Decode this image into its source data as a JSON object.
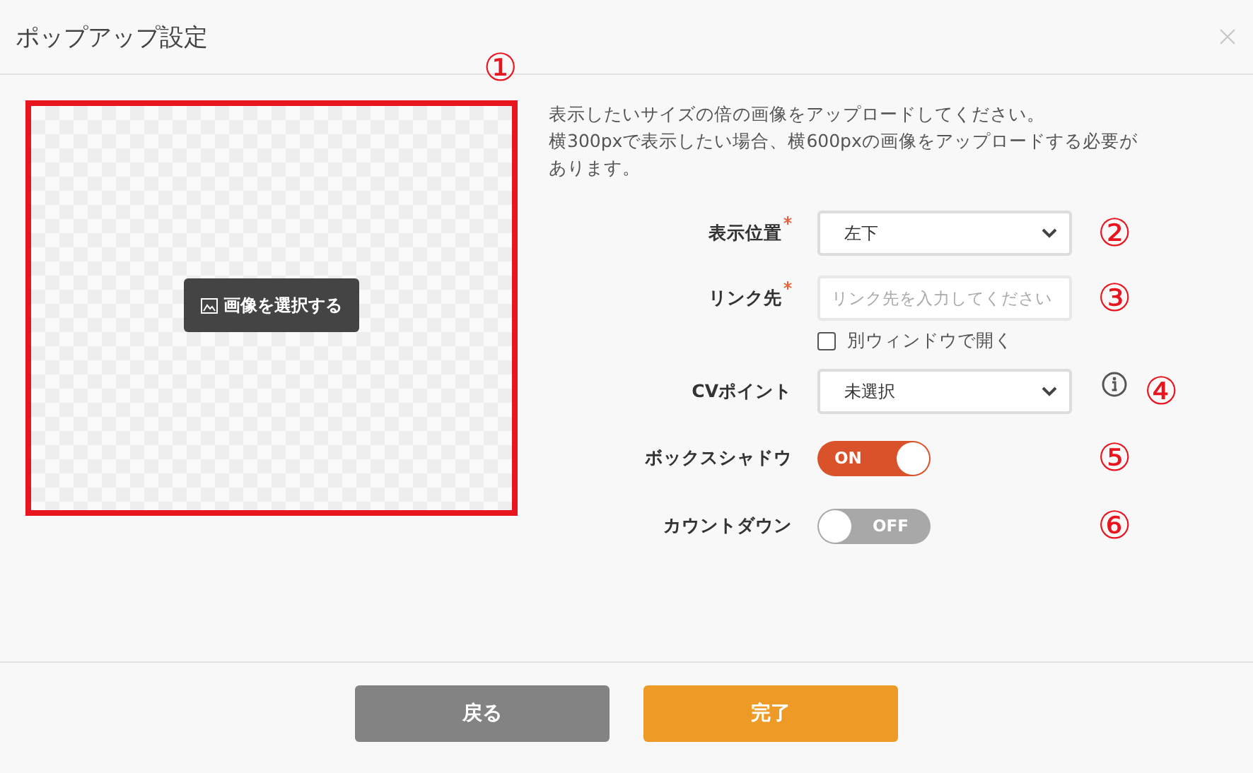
{
  "dialog": {
    "title": "ポップアップ設定"
  },
  "image_panel": {
    "button": "画像を選択する",
    "marker": "①"
  },
  "instructions": [
    "表示したいサイズの倍の画像をアップロードしてください。",
    "横300pxで表示したい場合、横600pxの画像をアップロードする必要があります。"
  ],
  "fields": [
    {
      "kind": "select",
      "label": "表示位置",
      "required": true,
      "value": "左下",
      "marker": "②"
    },
    {
      "kind": "text",
      "label": "リンク先",
      "required": true,
      "placeholder": "リンク先を入力してください",
      "marker": "③"
    },
    {
      "kind": "checkbox",
      "label": "別ウィンドウで開く",
      "checked": false
    },
    {
      "kind": "select",
      "label": "CVポイント",
      "required": false,
      "value": "未選択",
      "info": true,
      "marker": "④"
    },
    {
      "kind": "toggle",
      "label": "ボックスシャドウ",
      "on": true,
      "state_text": "ON",
      "marker": "⑤"
    },
    {
      "kind": "toggle",
      "label": "カウントダウン",
      "on": false,
      "state_text": "OFF",
      "marker": "⑥"
    }
  ],
  "buttons": [
    {
      "label": "戻る",
      "kind": "secondary"
    },
    {
      "label": "完了",
      "kind": "primary"
    }
  ]
}
